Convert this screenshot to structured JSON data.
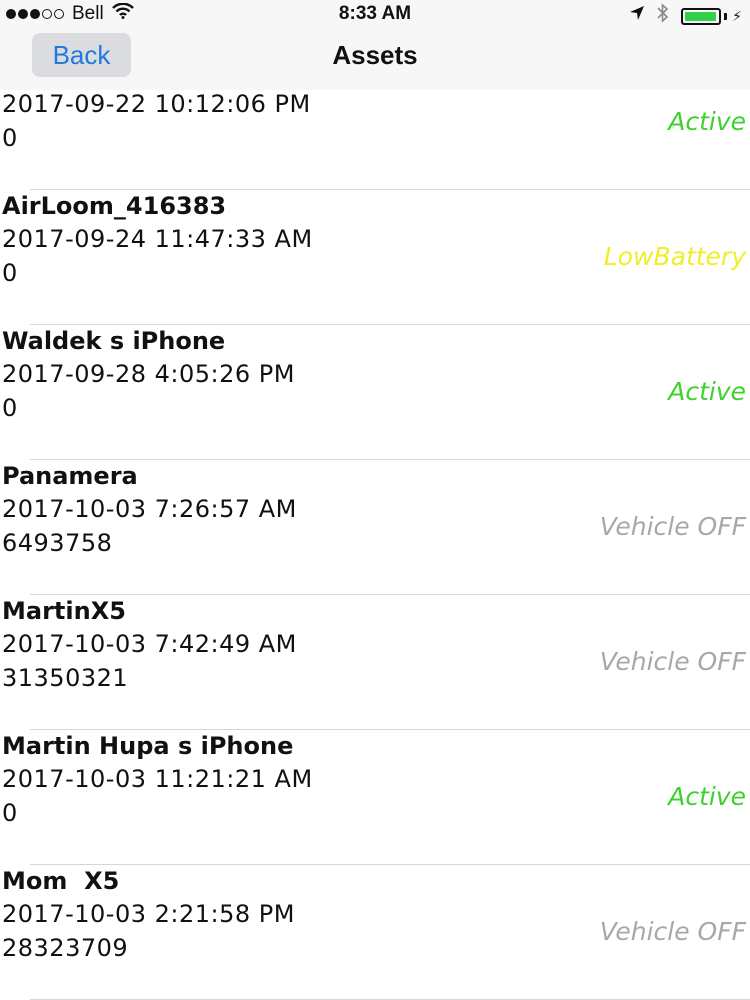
{
  "status_bar": {
    "signal_dots": [
      "full",
      "full",
      "full",
      "empty",
      "empty"
    ],
    "carrier": "Bell",
    "time": "8:33 AM",
    "battery_level": 0.95,
    "battery_color": "#33d14a"
  },
  "nav": {
    "back_label": "Back",
    "title": "Assets"
  },
  "status_colors": {
    "Active": "#3ed22e",
    "LowBattery": "#f0ee2a",
    "Vehicle OFF": "#a8a8a8"
  },
  "assets": [
    {
      "name": "",
      "date": "2017-09-22 10:12:06 PM",
      "value": "0",
      "status": "Active"
    },
    {
      "name": "AirLoom_416383",
      "date": "2017-09-24 11:47:33 AM",
      "value": "0",
      "status": "LowBattery"
    },
    {
      "name": "Waldek s iPhone",
      "date": "2017-09-28 4:05:26 PM",
      "value": "0",
      "status": "Active"
    },
    {
      "name": "Panamera",
      "date": "2017-10-03 7:26:57 AM",
      "value": "6493758",
      "status": "Vehicle OFF"
    },
    {
      "name": "MartinX5",
      "date": "2017-10-03 7:42:49 AM",
      "value": "31350321",
      "status": "Vehicle OFF"
    },
    {
      "name": "Martin Hupa s iPhone",
      "date": "2017-10-03 11:21:21 AM",
      "value": "0",
      "status": "Active"
    },
    {
      "name": "Mom  X5",
      "date": "2017-10-03 2:21:58 PM",
      "value": "28323709",
      "status": "Vehicle OFF"
    }
  ]
}
